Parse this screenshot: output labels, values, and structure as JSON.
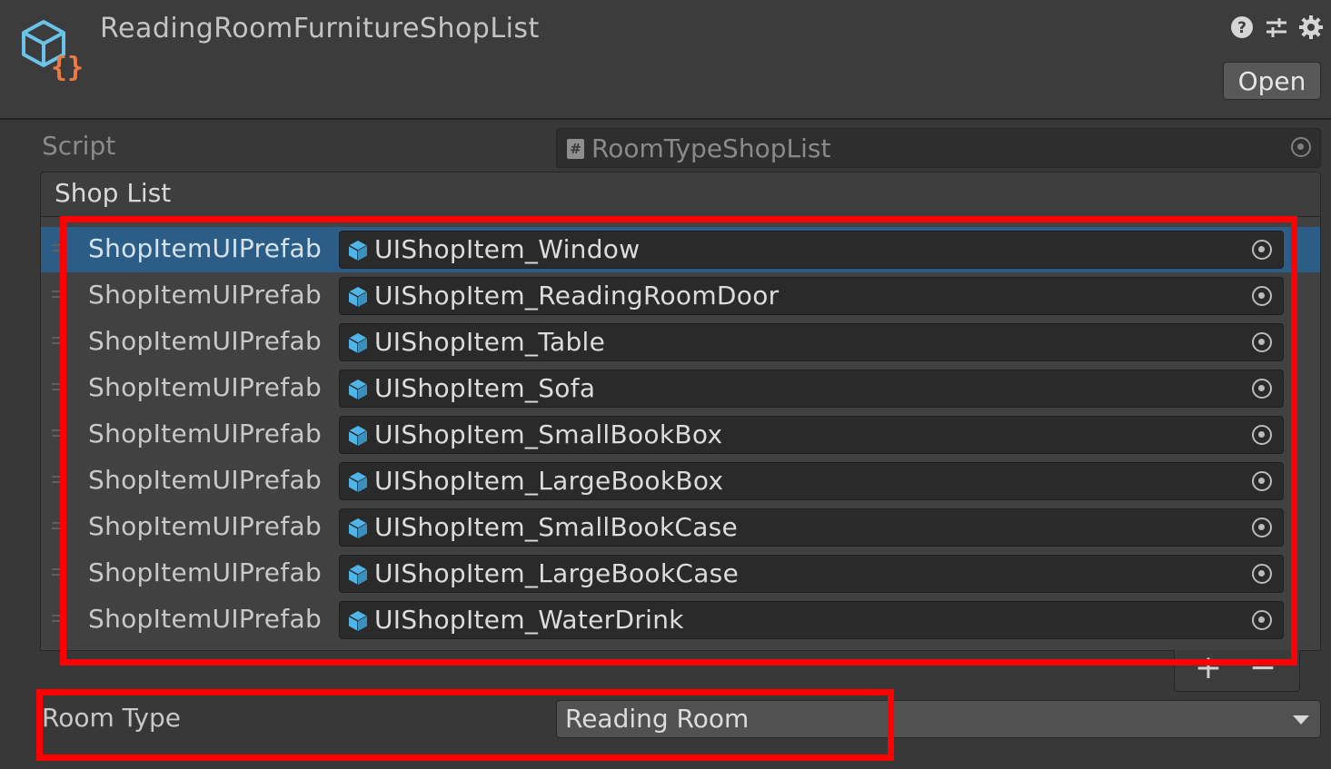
{
  "header": {
    "title": "ReadingRoomFurnitureShopList",
    "asset_icon": "scriptable-object-icon",
    "icons": [
      "help-icon",
      "preset-icon",
      "gear-icon"
    ],
    "open_label": "Open"
  },
  "script_field": {
    "label": "Script",
    "value": "RoomTypeShopList",
    "icon": "script-icon"
  },
  "shop_list": {
    "title": "Shop List",
    "element_label": "ShopItemUIPrefab",
    "items": [
      {
        "value": "UIShopItem_Window",
        "selected": true
      },
      {
        "value": "UIShopItem_ReadingRoomDoor"
      },
      {
        "value": "UIShopItem_Table"
      },
      {
        "value": "UIShopItem_Sofa"
      },
      {
        "value": "UIShopItem_SmallBookBox"
      },
      {
        "value": "UIShopItem_LargeBookBox"
      },
      {
        "value": "UIShopItem_SmallBookCase"
      },
      {
        "value": "UIShopItem_LargeBookCase"
      },
      {
        "value": "UIShopItem_WaterDrink"
      }
    ],
    "add_label": "+",
    "remove_label": "−"
  },
  "room_type": {
    "label": "Room Type",
    "value": "Reading Room"
  },
  "colors": {
    "highlight": "#ff0000",
    "selection": "#2c5d87",
    "prefab_icon": "#4fb4e6"
  }
}
